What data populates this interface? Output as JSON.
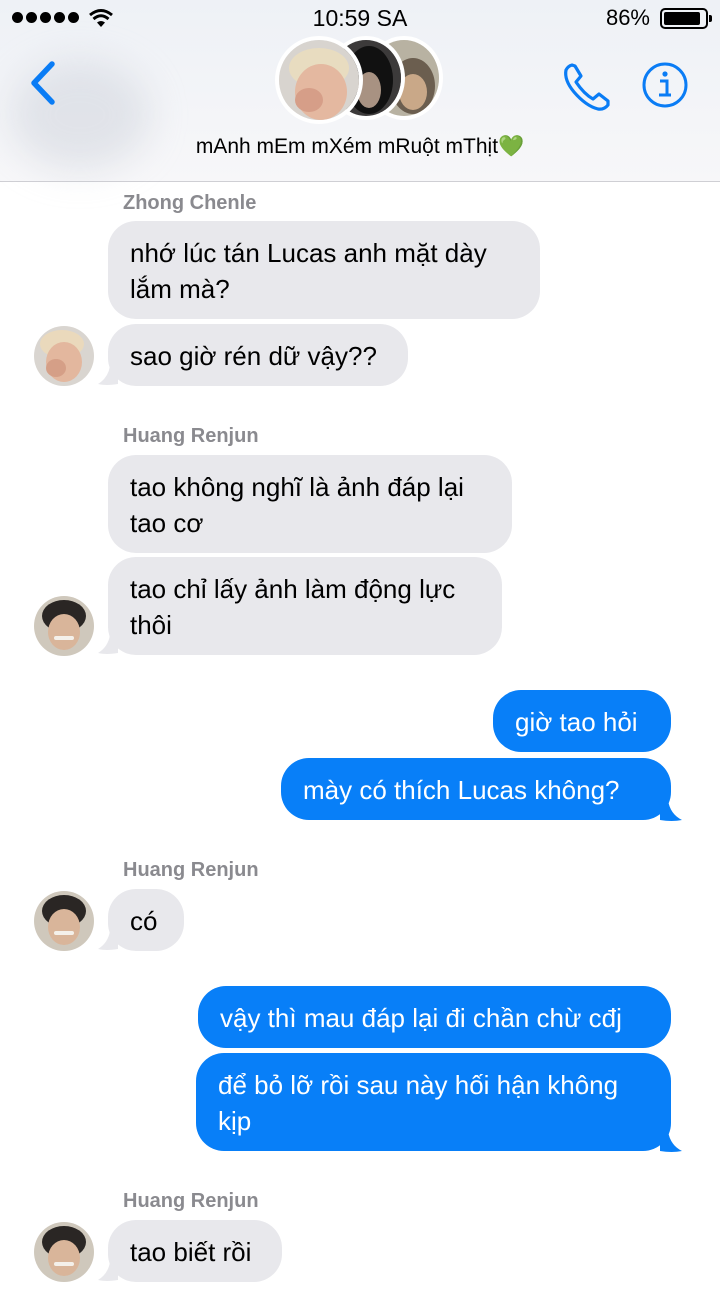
{
  "status": {
    "time": "10:59 SA",
    "battery": "86%"
  },
  "header": {
    "group_name": "mAnh mEm mXém mRuột mThịt💚"
  },
  "messages": [
    {
      "sender": "Zhong Chenle",
      "text": "nhớ lúc tán Lucas anh mặt dày\nlắm mà?"
    },
    {
      "text": "sao giờ rén dữ vậy??"
    },
    {
      "sender": "Huang Renjun",
      "text": "tao không nghĩ là ảnh đáp lại\ntao cơ"
    },
    {
      "text": "tao chỉ lấy ảnh làm động lực\nthôi"
    },
    {
      "text": "giờ tao hỏi"
    },
    {
      "text": "mày có thích Lucas không?"
    },
    {
      "sender": "Huang Renjun",
      "text": "có"
    },
    {
      "text": "vậy thì mau đáp lại đi chần chừ cđj"
    },
    {
      "text": "để bỏ lỡ rồi sau này hối hận không\nkịp"
    },
    {
      "sender": "Huang Renjun",
      "text": "tao biết rồi"
    }
  ],
  "colors": {
    "outgoing": "#087ff8",
    "incoming": "#e8e8ec",
    "accent": "#0a7cf5"
  },
  "icons": [
    "back-chevron-icon",
    "phone-icon",
    "info-icon",
    "wifi-icon",
    "battery-icon"
  ]
}
